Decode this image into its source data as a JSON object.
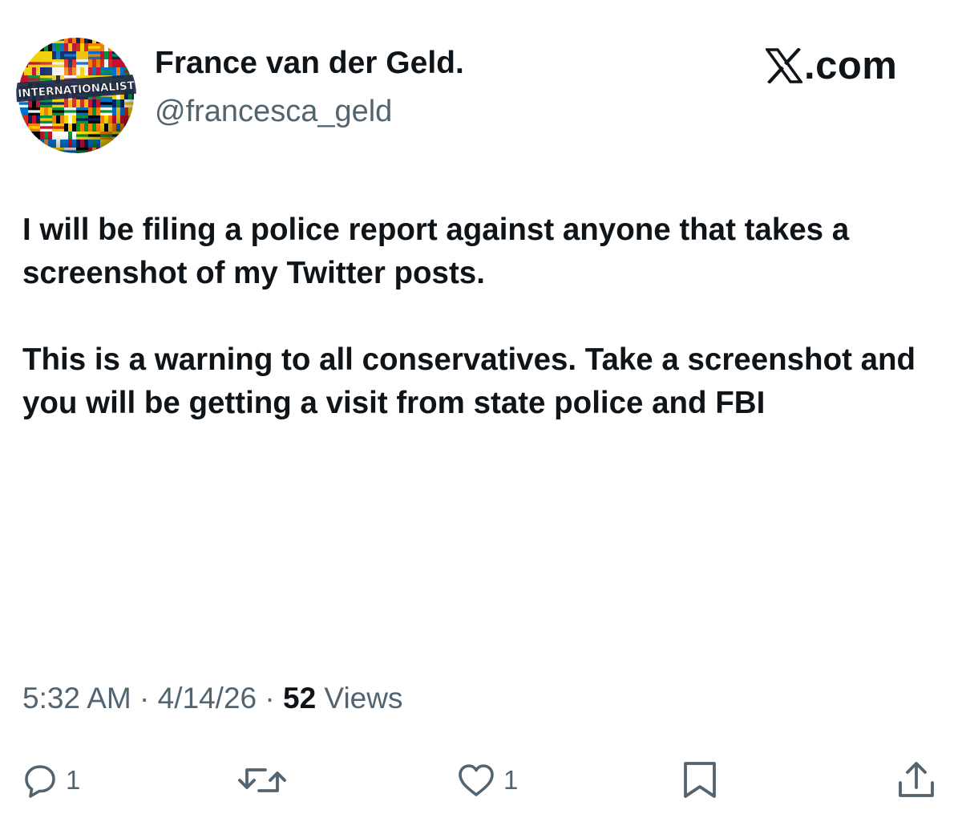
{
  "author": {
    "display_name": "France van der Geld.",
    "handle": "@francesca_geld",
    "avatar_label": "INTERNATIONALIST"
  },
  "brand": {
    "logo_icon": "x-logo-icon",
    "suffix": ".com"
  },
  "tweet": {
    "paragraphs": [
      "I will be filing a police report against anyone that takes a screenshot of my Twitter posts.",
      "This is a warning to all conservatives.  Take a screenshot and you will be getting a visit from state police and FBI"
    ]
  },
  "meta": {
    "time": "5:32 AM",
    "separator": " · ",
    "date": "4/14/26",
    "views_count": "52",
    "views_label": " Views"
  },
  "actions": {
    "reply": {
      "icon": "reply-icon",
      "count": "1"
    },
    "retweet": {
      "icon": "retweet-icon"
    },
    "like": {
      "icon": "heart-icon",
      "count": "1"
    },
    "bookmark": {
      "icon": "bookmark-icon"
    },
    "share": {
      "icon": "share-icon"
    }
  },
  "colors": {
    "text": "#0f1419",
    "secondary": "#536471",
    "background": "#ffffff"
  }
}
